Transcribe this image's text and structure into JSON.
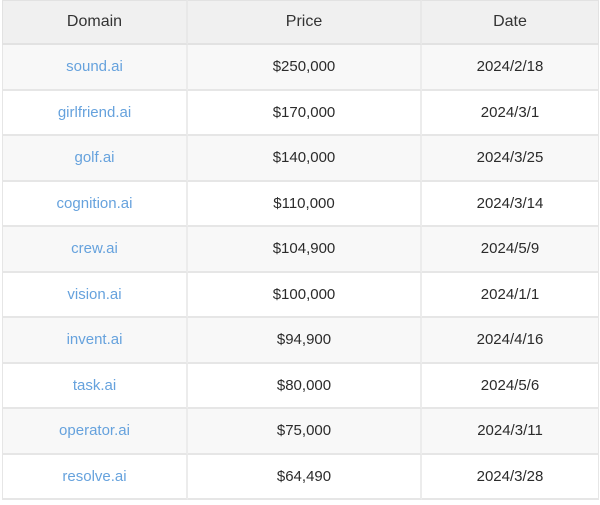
{
  "table": {
    "columns": [
      {
        "key": "domain",
        "label": "Domain"
      },
      {
        "key": "price",
        "label": "Price"
      },
      {
        "key": "date",
        "label": "Date"
      }
    ],
    "rows": [
      {
        "domain": "sound.ai",
        "price": "$250,000",
        "date": "2024/2/18"
      },
      {
        "domain": "girlfriend.ai",
        "price": "$170,000",
        "date": "2024/3/1"
      },
      {
        "domain": "golf.ai",
        "price": "$140,000",
        "date": "2024/3/25"
      },
      {
        "domain": "cognition.ai",
        "price": "$110,000",
        "date": "2024/3/14"
      },
      {
        "domain": "crew.ai",
        "price": "$104,900",
        "date": "2024/5/9"
      },
      {
        "domain": "vision.ai",
        "price": "$100,000",
        "date": "2024/1/1"
      },
      {
        "domain": "invent.ai",
        "price": "$94,900",
        "date": "2024/4/16"
      },
      {
        "domain": "task.ai",
        "price": "$80,000",
        "date": "2024/5/6"
      },
      {
        "domain": "operator.ai",
        "price": "$75,000",
        "date": "2024/3/11"
      },
      {
        "domain": "resolve.ai",
        "price": "$64,490",
        "date": "2024/3/28"
      }
    ]
  },
  "colors": {
    "link": "#66a2dd",
    "header_bg": "#f0f0f0",
    "header_text": "#333333",
    "row_alt_bg": "#f8f8f8",
    "row_bg": "#ffffff",
    "border": "#e6e6e6",
    "cell_text": "#262626"
  }
}
